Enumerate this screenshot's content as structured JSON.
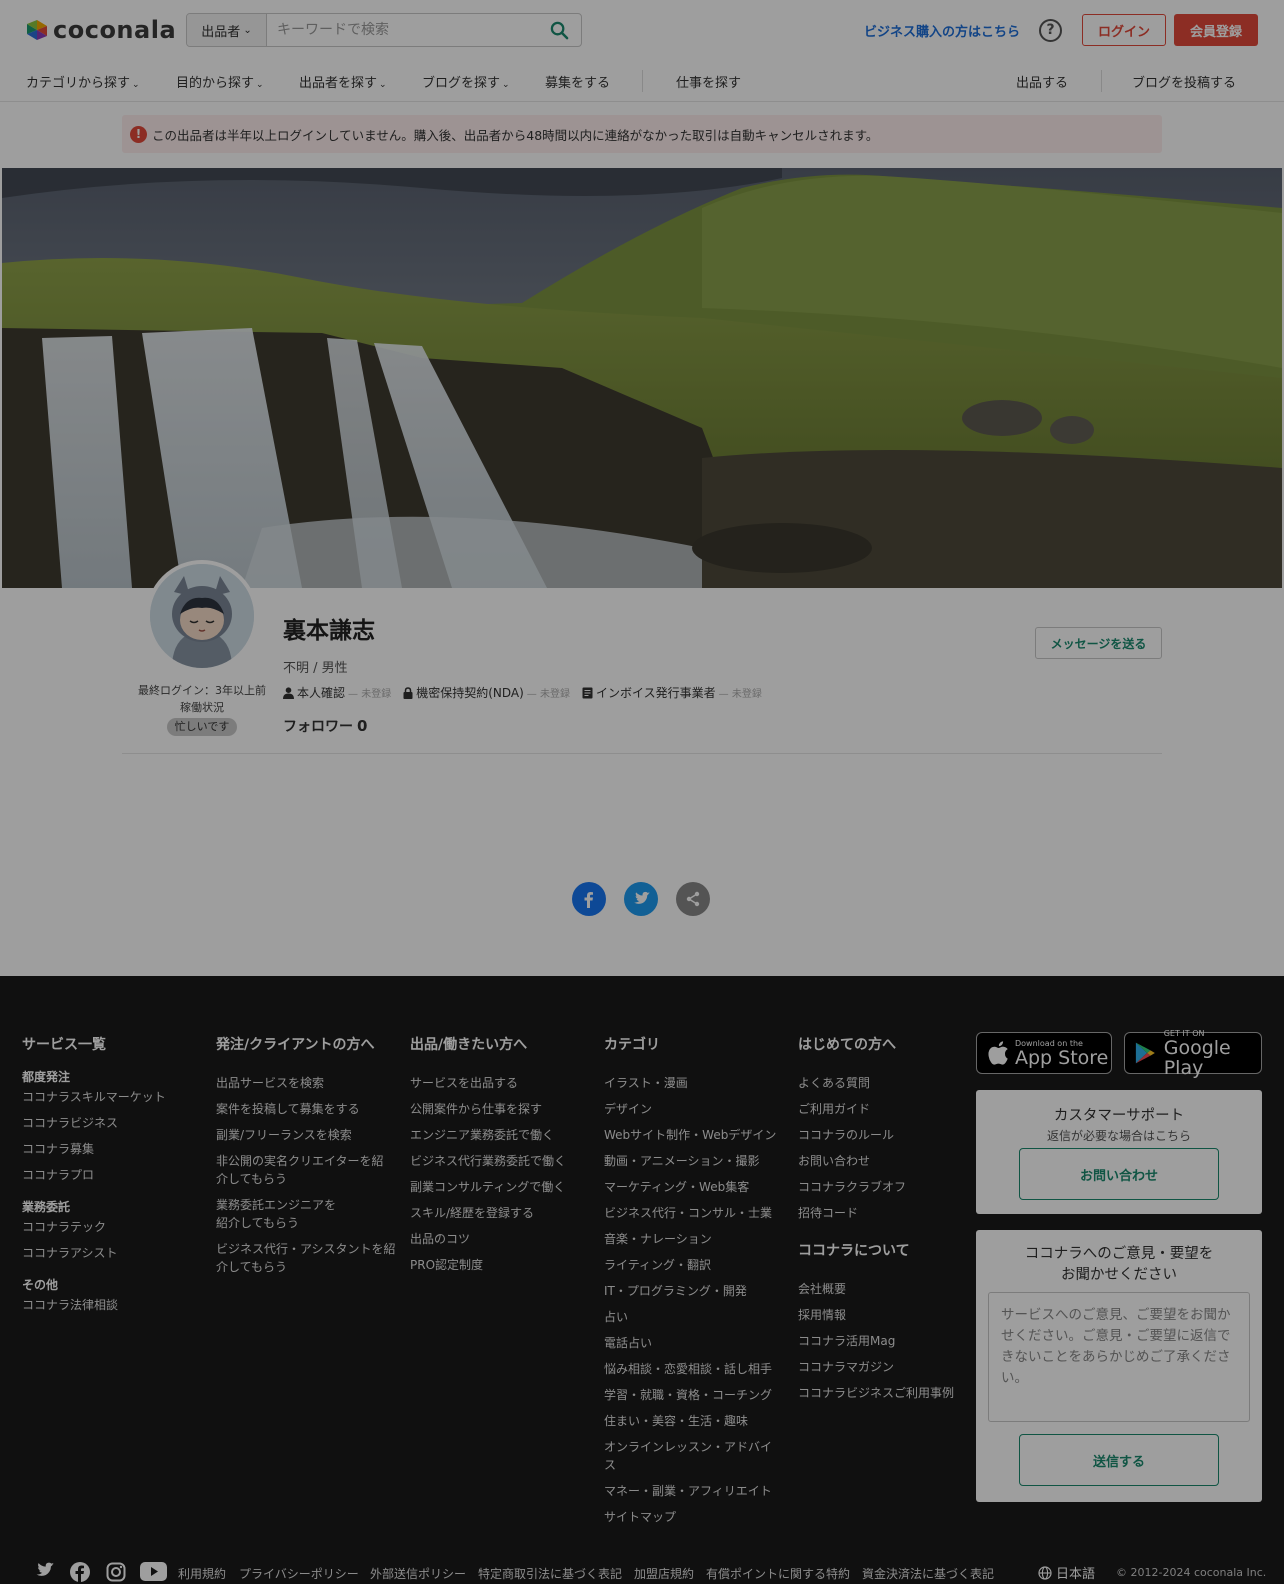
{
  "header": {
    "logo_text": "coconala",
    "search_category": "出品者",
    "search_placeholder": "キーワードで検索",
    "business_link": "ビジネス購入の方はこちら",
    "help_symbol": "?",
    "login_label": "ログイン",
    "register_label": "会員登録"
  },
  "nav": {
    "items": [
      {
        "label": "カテゴリから探す",
        "dropdown": true
      },
      {
        "label": "目的から探す",
        "dropdown": true
      },
      {
        "label": "出品者を探す",
        "dropdown": true
      },
      {
        "label": "ブログを探す",
        "dropdown": true
      },
      {
        "label": "募集をする",
        "dropdown": false
      },
      {
        "label": "仕事を探す",
        "dropdown": false
      },
      {
        "label": "出品する",
        "dropdown": false
      },
      {
        "label": "ブログを投稿する",
        "dropdown": false
      }
    ]
  },
  "alert": {
    "icon": "!",
    "text": "この出品者は半年以上ログインしていません。購入後、出品者から48時間以内に連絡がなかった取引は自動キャンセルされます。"
  },
  "profile": {
    "name": "裏本謙志",
    "meta": "不明 / 男性",
    "last_login": "最終ログイン：3年以上前",
    "activity_label": "稼働状況",
    "busy_badge": "忙しいです",
    "verifications": [
      {
        "label": "本人確認",
        "status": "— 未登録",
        "icon": "person-icon"
      },
      {
        "label": "機密保持契約(NDA)",
        "status": "— 未登録",
        "icon": "lock-icon"
      },
      {
        "label": "インボイス発行事業者",
        "status": "— 未登録",
        "icon": "document-icon"
      }
    ],
    "follower_label": "フォロワー",
    "follower_count": "0",
    "message_button": "メッセージを送る"
  },
  "footer": {
    "columns": [
      {
        "heading": "サービス一覧",
        "groups": [
          {
            "sub": "都度発注",
            "links": [
              "ココナラスキルマーケット",
              "ココナラビジネス",
              "ココナラ募集",
              "ココナラプロ"
            ]
          },
          {
            "sub": "業務委託",
            "links": [
              "ココナラテック",
              "ココナラアシスト"
            ]
          },
          {
            "sub": "その他",
            "links": [
              "ココナラ法律相談"
            ]
          }
        ]
      },
      {
        "heading": "発注/クライアントの方へ",
        "links": [
          "出品サービスを検索",
          "案件を投稿して募集をする",
          "副業/フリーランスを検索",
          "非公開の実名クリエイターを紹介してもらう",
          "業務委託エンジニアを紹介してもらう",
          "ビジネス代行・アシスタントを紹介してもらう"
        ]
      },
      {
        "heading": "出品/働きたい方へ",
        "links": [
          "サービスを出品する",
          "公開案件から仕事を探す",
          "エンジニア業務委託で働く",
          "ビジネス代行業務委託で働く",
          "副業コンサルティングで働く",
          "スキル/経歴を登録する",
          "出品のコツ",
          "PRO認定制度"
        ]
      },
      {
        "heading": "カテゴリ",
        "links": [
          "イラスト・漫画",
          "デザイン",
          "Webサイト制作・Webデザイン",
          "動画・アニメーション・撮影",
          "マーケティング・Web集客",
          "ビジネス代行・コンサル・士業",
          "音楽・ナレーション",
          "ライティング・翻訳",
          "IT・プログラミング・開発",
          "占い",
          "電話占い",
          "悩み相談・恋愛相談・話し相手",
          "学習・就職・資格・コーチング",
          "住まい・美容・生活・趣味",
          "オンラインレッスン・アドバイス",
          "マネー・副業・アフィリエイト",
          "サイトマップ"
        ]
      },
      {
        "heading": "はじめての方へ",
        "links": [
          "よくある質問",
          "ご利用ガイド",
          "ココナラのルール",
          "お問い合わせ",
          "ココナラクラブオフ",
          "招待コード"
        ],
        "heading2": "ココナラについて",
        "links2": [
          "会社概要",
          "採用情報",
          "ココナラ活用Mag",
          "ココナラマガジン",
          "ココナラビジネスご利用事例"
        ]
      }
    ],
    "app_store": {
      "small": "Download on the",
      "big": "App Store"
    },
    "google_play": {
      "small": "GET IT ON",
      "big": "Google Play"
    },
    "support": {
      "title": "カスタマーサポート",
      "subtitle": "返信が必要な場合はこちら",
      "button": "お問い合わせ"
    },
    "feedback": {
      "title_line1": "ココナラへのご意見・要望を",
      "title_line2": "お聞かせください",
      "placeholder": "サービスへのご意見、ご要望をお聞かせください。ご意見・ご要望に返信できないことをあらかじめご了承ください。",
      "button": "送信する"
    },
    "legal_links": [
      "利用規約",
      "プライバシーポリシー",
      "外部送信ポリシー",
      "特定商取引法に基づく表記",
      "加盟店規約",
      "有償ポイントに関する特約",
      "資金決済法に基づく表記"
    ],
    "language": "日本語",
    "copyright": "© 2012-2024 coconala Inc."
  },
  "colors": {
    "brand_red": "#e24a3b",
    "link_blue": "#1e6fd9",
    "green_accent": "#1b8a6f",
    "footer_bg": "#1a1a1a",
    "facebook": "#1877f2",
    "twitter": "#1d9bf0"
  }
}
